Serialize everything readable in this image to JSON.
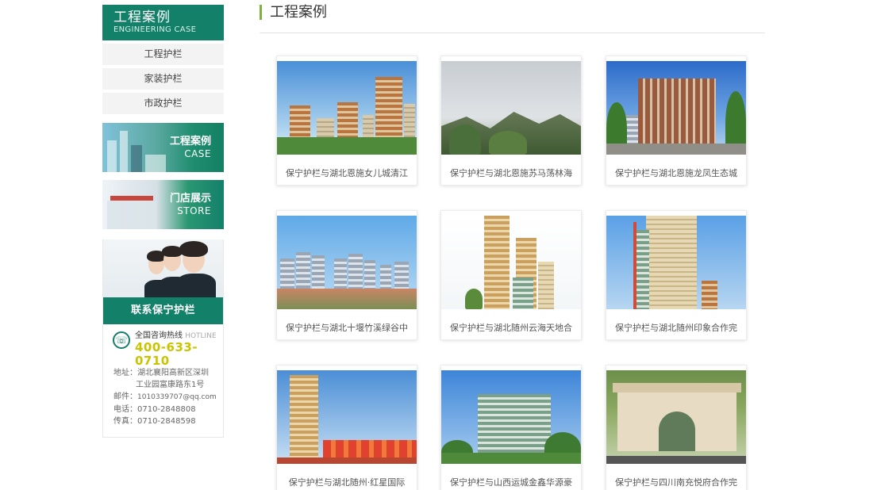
{
  "sidebar": {
    "header": {
      "title": "工程案例",
      "subtitle": "ENGINEERING CASE"
    },
    "menu": [
      {
        "label": "工程护栏"
      },
      {
        "label": "家装护栏"
      },
      {
        "label": "市政护栏"
      }
    ],
    "banners": [
      {
        "title": "工程案例",
        "subtitle": "CASE"
      },
      {
        "title": "门店展示",
        "subtitle": "STORE"
      }
    ],
    "contact": {
      "title": "联系保宁护栏",
      "hotline_label": "全国咨询热线",
      "hotline_en": "HOTLINE",
      "hotline_number": "400-633-0710",
      "address_label": "地址：",
      "address_line1": "湖北襄阳高新区深圳",
      "address_line2": "工业园富康路东1号",
      "email_label": "邮件：",
      "email": "1010339707@qq.com",
      "phone_label": "电话：",
      "phone": "0710-2848808",
      "fax_label": "传真：",
      "fax": "0710-2848598"
    }
  },
  "main": {
    "title": "工程案例",
    "cases": [
      {
        "caption": "保宁护栏与湖北恩施女儿城清江"
      },
      {
        "caption": "保宁护栏与湖北恩施苏马荡林海"
      },
      {
        "caption": "保宁护栏与湖北恩施龙凤生态城"
      },
      {
        "caption": "保宁护栏与湖北十堰竹溪绿谷中"
      },
      {
        "caption": "保宁护栏与湖北随州云海天地合"
      },
      {
        "caption": "保宁护栏与湖北随州印象合作完"
      },
      {
        "caption": "保宁护栏与湖北随州·红星国际"
      },
      {
        "caption": "保宁护栏与山西运城金鑫华源豪"
      },
      {
        "caption": "保宁护栏与四川南充悦府合作完"
      }
    ]
  },
  "colors": {
    "brand_green": "#13806a",
    "accent_bar": "#7bb33d",
    "hotline_yellow": "#c9c400"
  },
  "icons": {
    "phone": "phone-icon"
  }
}
